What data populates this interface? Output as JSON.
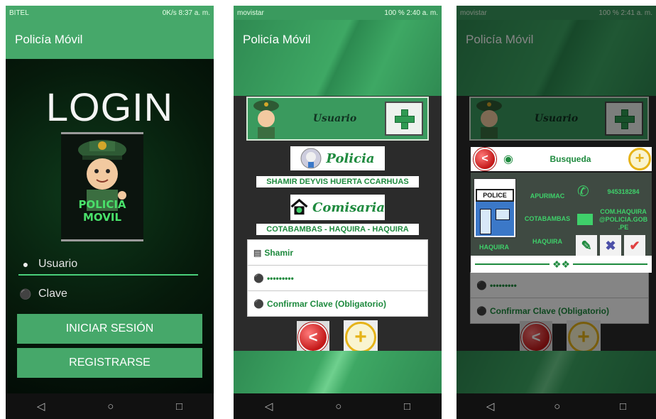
{
  "phone1": {
    "status": {
      "left": "BITEL",
      "right": "0K/s 8:37 a. m."
    },
    "app_title": "Policía Móvil",
    "login_title": "LOGIN",
    "logo_text": "POLICIA MOVIL",
    "username_placeholder": "Usuario",
    "password_placeholder": "Clave",
    "login_button": "INICIAR SESIÓN",
    "register_button": "REGISTRARSE"
  },
  "phone2": {
    "status": {
      "left": "movistar",
      "right": "100 % 2:40 a. m."
    },
    "app_title": "Policía Móvil",
    "usuario_label": "Usuario",
    "policia_label": "Policia",
    "officer_name": "SHAMIR DEYVIS HUERTA CCARHUAS",
    "comisaria_label": "Comisaria",
    "location": "COTABAMBAS - HAQUIRA - HAQUIRA",
    "form": {
      "username_value": "Shamir",
      "password_value": "•••••••••",
      "confirm_placeholder": "Confirmar Clave (Obligatorio)"
    }
  },
  "phone3": {
    "status": {
      "left": "movistar",
      "right": "100 % 2:41 a. m."
    },
    "app_title": "Policía Móvil",
    "usuario_label": "Usuario",
    "search_label": "Busqueda",
    "card": {
      "sign": "POLICE",
      "region": "APURIMAC",
      "province": "COTABAMBAS",
      "district": "HAQUIRA",
      "district2": "HAQUIRA",
      "phone": "945318284",
      "email": "COM.HAQUIRA @POLICIA.GOB .PE"
    },
    "password_value": "•••••••••",
    "confirm_placeholder": "Confirmar Clave (Obligatorio)"
  },
  "nav": {
    "back": "◁",
    "home": "○",
    "recent": "□"
  },
  "colors": {
    "primary_green": "#46a86a",
    "label_green": "#1e8a3e",
    "accent_red": "#c31818",
    "accent_yellow": "#e6b318"
  }
}
